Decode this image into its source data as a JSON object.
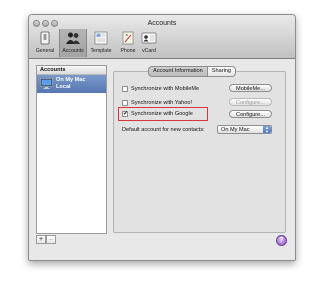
{
  "window": {
    "title": "Accounts"
  },
  "toolbar": {
    "items": [
      {
        "label": "General",
        "icon": "switch-icon"
      },
      {
        "label": "Accounts",
        "icon": "people-icon"
      },
      {
        "label": "Template",
        "icon": "template-icon"
      },
      {
        "label": "Phone",
        "icon": "phone-icon"
      },
      {
        "label": "vCard",
        "icon": "vcard-icon"
      }
    ],
    "active": "Accounts"
  },
  "sidebar": {
    "header": "Accounts",
    "accounts": [
      {
        "name": "On My Mac",
        "type": "Local",
        "icon": "computer-icon"
      }
    ]
  },
  "tabs": [
    {
      "label": "Account Information",
      "selected": true
    },
    {
      "label": "Sharing",
      "selected": false
    }
  ],
  "sync": [
    {
      "label": "Synchronize with MobileMe",
      "checked": false,
      "button": "MobileMe...",
      "button_enabled": true
    },
    {
      "label": "Synchronize with Yahoo!",
      "checked": false,
      "button": "Configure...",
      "button_enabled": false
    },
    {
      "label": "Synchronize with Google",
      "checked": true,
      "button": "Configure...",
      "button_enabled": true
    }
  ],
  "default_account": {
    "label": "Default account for new contacts:",
    "value": "On My Mac"
  },
  "bottom": {
    "add": "+",
    "remove": "–",
    "help": "?"
  },
  "colors": {
    "highlight": "#d9363c",
    "selection": "#5677b2"
  }
}
